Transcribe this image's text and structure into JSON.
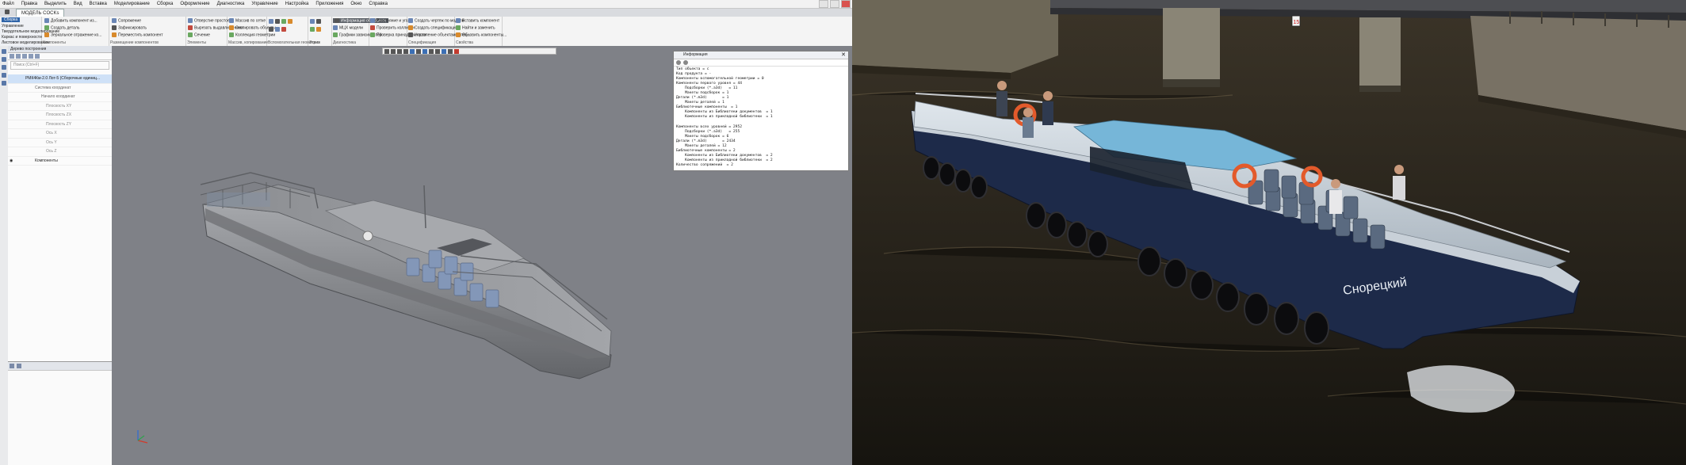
{
  "menu": [
    "Файл",
    "Правка",
    "Выделить",
    "Вид",
    "Вставка",
    "Моделирование",
    "Сборка",
    "Оформление",
    "Диагностика",
    "Управление",
    "Настройка",
    "Приложения",
    "Окно",
    "Справка"
  ],
  "app_tab": "МОДЕЛЬ COCKs",
  "ribbon_left_tabs": [
    "Сборка",
    "Управление",
    "Твердотельное моделирование",
    "Каркас и поверхности",
    "Листовое моделирование"
  ],
  "ribbon": {
    "groups": [
      {
        "id": "components",
        "label": "Компоненты",
        "buttons": [
          "Добавить компонент из...",
          "Создать деталь",
          "Зеркальное отражение ко..."
        ]
      },
      {
        "id": "component_placement",
        "label": "Размещение компонентов",
        "buttons": [
          "Сопряжение",
          "Зафиксировать",
          "Переместить компонент"
        ]
      },
      {
        "id": "elements",
        "label": "Элементы",
        "buttons": [
          "Отверстие простое",
          "Вырезать выдавливанием",
          "Сечение"
        ]
      },
      {
        "id": "arrays",
        "label": "Массив, копирование",
        "buttons": [
          "Массив по сетке",
          "Скопировать объекты",
          "Коллекция геометрии"
        ]
      },
      {
        "id": "aux_geometry",
        "label": "Вспомогательная геометрия",
        "buttons": []
      },
      {
        "id": "sketch",
        "label": "Эскиз",
        "buttons": []
      },
      {
        "id": "diagnostics",
        "label": "Диагностика",
        "buttons": [
          "Информация об объекте",
          "МЦХ модели",
          "Графики зависимостей"
        ]
      },
      {
        "id": "measure",
        "label": "Измерения",
        "buttons": [
          "Расстояние и угол",
          "Проверить коллизии",
          "Проверка принадлежности"
        ]
      },
      {
        "id": "specification",
        "label": "Спецификация",
        "buttons": [
          "Создать чертеж по модели",
          "Создать спецификацию",
          "Управление объектами спец..."
        ]
      },
      {
        "id": "properties",
        "label": "Свойства",
        "buttons": [
          "Вставить компонент",
          "Найти и заменить",
          "Обновить компоненты..."
        ]
      }
    ]
  },
  "tree": {
    "title": "Дерево построения",
    "search_placeholder": "Поиск (Ctrl+F)",
    "rows": [
      {
        "label": "РМК4Км-2.0 Лот-5 (Сборочные единиц...",
        "level": 0,
        "selected": true
      },
      {
        "label": "Система координат",
        "level": 1,
        "selected": false
      },
      {
        "label": "Начало координат",
        "level": 2,
        "selected": false
      },
      {
        "label": "Плоскость XY",
        "level": 3,
        "selected": false
      },
      {
        "label": "Плоскость ZX",
        "level": 3,
        "selected": false
      },
      {
        "label": "Плоскость ZY",
        "level": 3,
        "selected": false
      },
      {
        "label": "Ось X",
        "level": 3,
        "selected": false
      },
      {
        "label": "Ось Y",
        "level": 3,
        "selected": false
      },
      {
        "label": "Ось Z",
        "level": 3,
        "selected": false
      },
      {
        "label": "Компоненты",
        "level": 1,
        "selected": false
      }
    ]
  },
  "info_panel": {
    "title": "Информация",
    "text": "Тип объекта = с\nКод продукта = -\nКомпоненты вспомогательной геометрии = 0\nКомпоненты первого уровня = 44\n    Подсборки (*.a3d)   = 11\n    Макеты подсборок = 1\nДетали (*.m3d)       = 1\n    Макеты деталей = 1\nБиблиотечные компоненты  = 1\n    Компоненты из Библиотеки документов  = 1\n    Компоненты из прикладной библиотеки  = 1\n\nКомпоненты всех уровней = 2952\n    Подсборки (*.a3d)   = 255\n    Макеты подсборок = 6\nДетали (*.m3d)       = 2434\n    Макеты деталей = 12\nБиблиотечные компоненты = 2\n    Компоненты из Библиотеки документов  = 2\n    Компоненты из прикладной библиотеки  = 2\nКоличество сопряжений  = 2"
  },
  "photo": {
    "hull_name": "Снорецкий",
    "sign_number": "15"
  }
}
